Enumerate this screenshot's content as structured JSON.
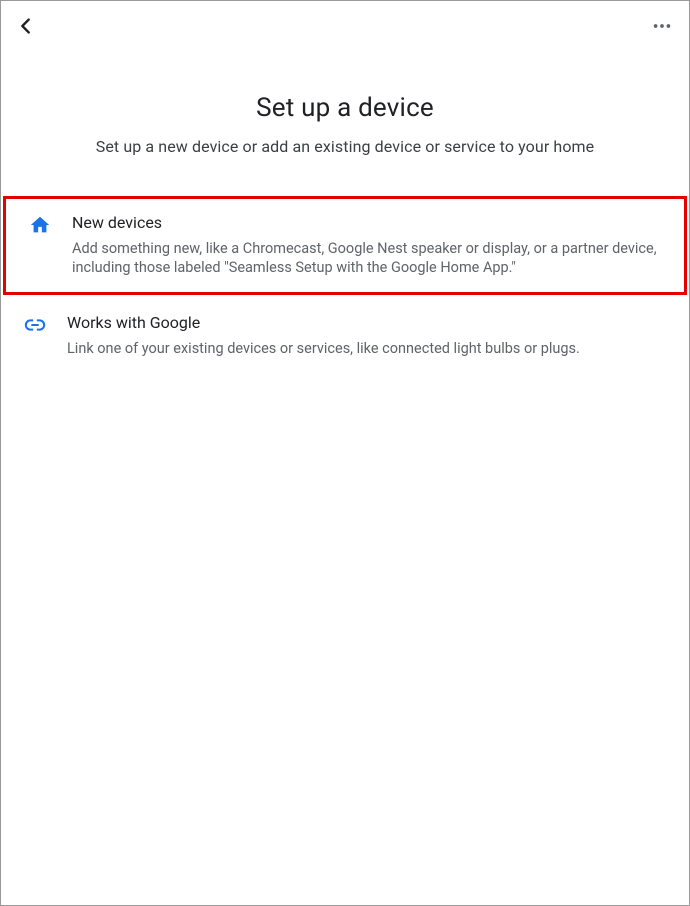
{
  "header": {
    "title": "Set up a device",
    "subtitle": "Set up a new device or add an existing device or service to your home"
  },
  "options": {
    "new_devices": {
      "title": "New devices",
      "desc": "Add something new, like a Chromecast, Google Nest speaker or display, or a partner device, including those labeled \"Seamless Setup with the Google Home App.\""
    },
    "works_with_google": {
      "title": "Works with Google",
      "desc": "Link one of your existing devices or services, like connected light bulbs or plugs."
    }
  }
}
